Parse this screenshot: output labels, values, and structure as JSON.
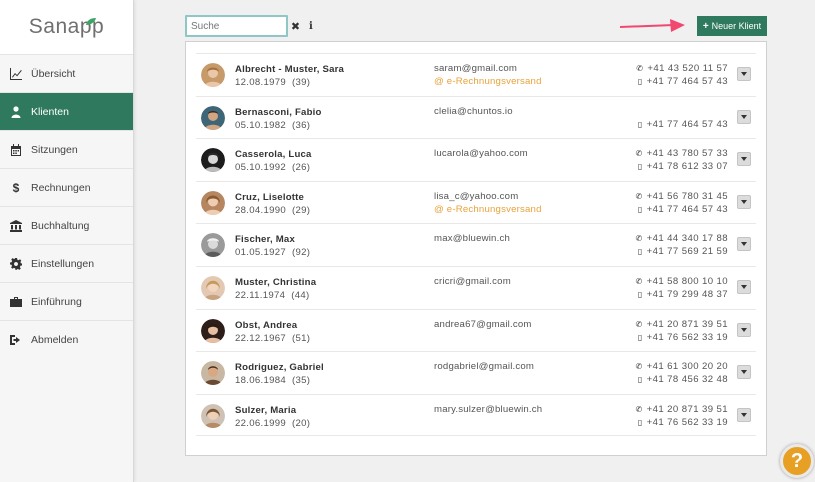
{
  "app": {
    "logo": "Sanapp"
  },
  "sidebar": {
    "items": [
      {
        "label": "Übersicht",
        "icon": "chart-line-icon"
      },
      {
        "label": "Klienten",
        "icon": "user-icon",
        "active": true
      },
      {
        "label": "Sitzungen",
        "icon": "calendar-icon"
      },
      {
        "label": "Rechnungen",
        "icon": "dollar-icon"
      },
      {
        "label": "Buchhaltung",
        "icon": "bank-icon"
      },
      {
        "label": "Einstellungen",
        "icon": "gear-icon"
      },
      {
        "label": "Einführung",
        "icon": "briefcase-icon"
      },
      {
        "label": "Abmelden",
        "icon": "sign-out-icon"
      }
    ]
  },
  "search": {
    "placeholder": "Suche",
    "value": ""
  },
  "toolbar": {
    "new_client_label": "Neuer Klient"
  },
  "clients": [
    {
      "name": "Albrecht - Muster, Sara",
      "dob": "12.08.1979",
      "age": "(39)",
      "email": "saram@gmail.com",
      "ebill": "@ e-Rechnungsversand",
      "phone": "+41 43 520 11 57",
      "mobile": "+41 77 464 57 43"
    },
    {
      "name": "Bernasconi, Fabio",
      "dob": "05.10.1982",
      "age": "(36)",
      "email": "clelia@chuntos.io",
      "ebill": "",
      "phone": "",
      "mobile": "+41 77 464 57 43"
    },
    {
      "name": "Casserola, Luca",
      "dob": "05.10.1992",
      "age": "(26)",
      "email": "lucarola@yahoo.com",
      "ebill": "",
      "phone": "+41 43 780 57 33",
      "mobile": "+41 78 612 33 07"
    },
    {
      "name": "Cruz, Liselotte",
      "dob": "28.04.1990",
      "age": "(29)",
      "email": "lisa_c@yahoo.com",
      "ebill": "@ e-Rechnungsversand",
      "phone": "+41 56 780 31 45",
      "mobile": "+41 77 464 57 43"
    },
    {
      "name": "Fischer, Max",
      "dob": "01.05.1927",
      "age": "(92)",
      "email": "max@bluewin.ch",
      "ebill": "",
      "phone": "+41 44 340 17 88",
      "mobile": "+41 77 569 21 59"
    },
    {
      "name": "Muster, Christina",
      "dob": "22.11.1974",
      "age": "(44)",
      "email": "cricri@gmail.com",
      "ebill": "",
      "phone": "+41 58 800 10 10",
      "mobile": "+41 79 299 48 37"
    },
    {
      "name": "Obst, Andrea",
      "dob": "22.12.1967",
      "age": "(51)",
      "email": "andrea67@gmail.com",
      "ebill": "",
      "phone": "+41 20 871 39 51",
      "mobile": "+41 76 562 33 19"
    },
    {
      "name": "Rodriguez, Gabriel",
      "dob": "18.06.1984",
      "age": "(35)",
      "email": "rodgabriel@gmail.com",
      "ebill": "",
      "phone": "+41 61 300 20 20",
      "mobile": "+41 78 456 32 48"
    },
    {
      "name": "Sulzer, Maria",
      "dob": "22.06.1999",
      "age": "(20)",
      "email": "mary.sulzer@bluewin.ch",
      "ebill": "",
      "phone": "+41 20 871 39 51",
      "mobile": "+41 76 562 33 19"
    }
  ],
  "help": {
    "label": "?"
  },
  "colors": {
    "brand": "#2f7a5e",
    "accent": "#e8a23a",
    "arrow": "#f0486e"
  }
}
